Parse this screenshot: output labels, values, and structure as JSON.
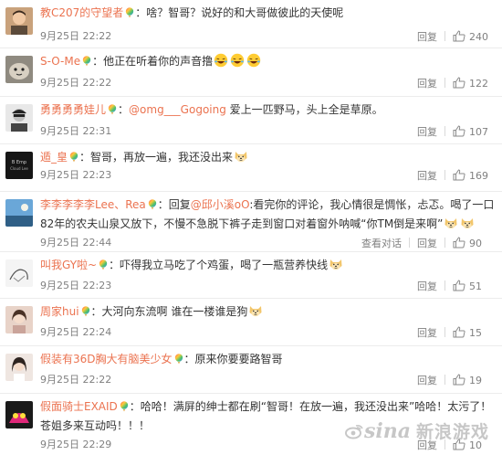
{
  "comments": [
    {
      "username": "教C207的守望者",
      "segments": [
        {
          "type": "text",
          "value": "：啥？智哥？说好的和大哥做彼此的天使呢"
        }
      ],
      "time": "9月25日 22:22",
      "reply_label": "回复",
      "likes": "240"
    },
    {
      "username": "S-O-Me",
      "segments": [
        {
          "type": "text",
          "value": "：他正在听着你的声音撸"
        },
        {
          "type": "emoji",
          "name": "laugh-cry-emoji"
        },
        {
          "type": "emoji",
          "name": "laugh-cry-emoji"
        },
        {
          "type": "emoji",
          "name": "laugh-cry-emoji"
        }
      ],
      "time": "9月25日 22:22",
      "reply_label": "回复",
      "likes": "122"
    },
    {
      "username": "勇勇勇勇娃儿",
      "segments": [
        {
          "type": "text",
          "value": "："
        },
        {
          "type": "mention",
          "value": "@omg___Gogoing"
        },
        {
          "type": "text",
          "value": " 爱上一匹野马，头上全是草原。"
        }
      ],
      "time": "9月25日 22:31",
      "reply_label": "回复",
      "likes": "107"
    },
    {
      "username": "遁_皇",
      "segments": [
        {
          "type": "text",
          "value": "：智哥，再放一遍，我还没出来"
        },
        {
          "type": "emoji",
          "name": "doge-emoji"
        }
      ],
      "time": "9月25日 22:23",
      "reply_label": "回复",
      "likes": "169"
    },
    {
      "username": "李李李李李Lee、Rea",
      "segments": [
        {
          "type": "text",
          "value": "：回复"
        },
        {
          "type": "mention",
          "value": "@邱小溪oO"
        },
        {
          "type": "text",
          "value": ":看完你的评论，我心情很是惆怅，忐忑。喝了一口82年的农夫山泉又放下，不慢不急脱下裤子走到窗口对着窗外呐喊“你TM倒是来啊”"
        },
        {
          "type": "emoji",
          "name": "doge-emoji"
        },
        {
          "type": "emoji",
          "name": "doge-emoji"
        }
      ],
      "time": "9月25日 22:44",
      "view_replies_label": "查看对话",
      "reply_label": "回复",
      "likes": "90"
    },
    {
      "username": "叫我GY啦~",
      "segments": [
        {
          "type": "text",
          "value": "：吓得我立马吃了个鸡蛋，喝了一瓶营养快线"
        },
        {
          "type": "emoji",
          "name": "doge-emoji"
        }
      ],
      "time": "9月25日 22:23",
      "reply_label": "回复",
      "likes": "51"
    },
    {
      "username": "周家hui",
      "segments": [
        {
          "type": "text",
          "value": "：大河向东流啊 谁在一楼谁是狗"
        },
        {
          "type": "emoji",
          "name": "doge-emoji"
        }
      ],
      "time": "9月25日 22:24",
      "reply_label": "回复",
      "likes": "15"
    },
    {
      "username": "假装有36D胸大有脑美少女",
      "segments": [
        {
          "type": "text",
          "value": "：原来你要要路智哥"
        }
      ],
      "time": "9月25日 22:22",
      "reply_label": "回复",
      "likes": "19"
    },
    {
      "username": "假面骑士EXAID",
      "segments": [
        {
          "type": "text",
          "value": "：哈哈！满屏的绅士都在刷“智哥！在放一遍，我还没出来”哈哈！太污了！苍姐多来互动吗！！！"
        }
      ],
      "time": "9月25日 22:29",
      "reply_label": "回复",
      "likes": "10"
    }
  ],
  "watermark": {
    "latin": "sina",
    "chinese": "新浪游戏"
  },
  "colors": {
    "username": "#eb7350",
    "meta": "#808080",
    "separator": "#ececec"
  }
}
